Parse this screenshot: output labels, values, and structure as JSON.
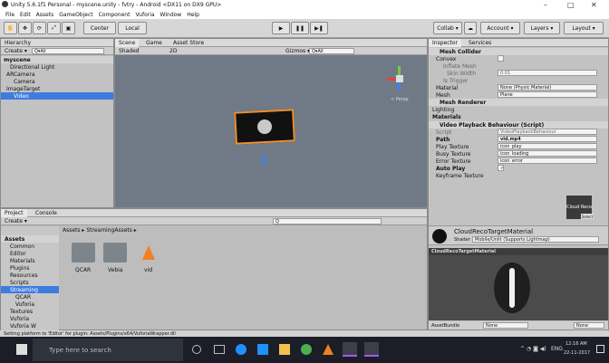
{
  "title": "Unity 5.6.1f1 Personal - myscene.unity - fvtry - Android <DX11 on DX9 GPU>",
  "menu": [
    "File",
    "Edit",
    "Assets",
    "GameObject",
    "Component",
    "Vuforia",
    "Window",
    "Help"
  ],
  "toolbar": {
    "center": "Center",
    "local": "Local",
    "collab": "Collab ▾",
    "account": "Account ▾",
    "layers": "Layers ▾",
    "layout": "Layout ▾"
  },
  "hierarchy": {
    "tab": "Hierarchy",
    "create": "Create ▾",
    "search": "Q▾All",
    "items": [
      "myscene",
      "Directional Light",
      "ARCamera",
      "Camera",
      "ImageTarget",
      "Video"
    ]
  },
  "scene": {
    "tab": "Scene",
    "game": "Game",
    "store": "Asset Store",
    "shaded": "Shaded",
    "d2": "2D",
    "gizmos": "Gizmos ▾",
    "persp": "< Persp"
  },
  "inspector": {
    "tab": "Inspector",
    "services": "Services",
    "mesh_collider": {
      "title": "Mesh Collider",
      "rows": [
        [
          "Convex",
          ""
        ],
        [
          "Inflate Mesh",
          ""
        ],
        [
          "Skin Width",
          "0.01"
        ],
        [
          "Is Trigger",
          ""
        ],
        [
          "Material",
          "None (Physic Material)"
        ],
        [
          "Mesh",
          "Plane"
        ]
      ]
    },
    "mesh_renderer": "Mesh Renderer",
    "lighting": "Lighting",
    "materials": "Materials",
    "video": {
      "title": "Video Playback Behaviour (Script)",
      "rows": [
        [
          "Script",
          "VideoPlaybackBehaviour"
        ],
        [
          "Path",
          "vid.mp4"
        ],
        [
          "Play Texture",
          "icon_play"
        ],
        [
          "Busy Texture",
          "icon_loading"
        ],
        [
          "Error Texture",
          "icon_error"
        ],
        [
          "Auto Play",
          ""
        ],
        [
          "Keyframe Texture",
          ""
        ]
      ]
    },
    "reco": "Cloud Reco",
    "select": "Select",
    "material": {
      "name": "CloudRecoTargetMaterial",
      "shader_label": "Shader",
      "shader": "Mobile/Unlit (Supports Lightmap)"
    },
    "preview": "CloudRecoTargetMaterial",
    "assetbundle": "AssetBundle",
    "none": "None"
  },
  "project": {
    "tab": "Project",
    "console": "Console",
    "create": "Create ▾",
    "breadcrumb": "Assets ▸ StreamingAssets ▸",
    "tree": [
      "Assets",
      "Common",
      "Editor",
      "Materials",
      "Plugins",
      "Resources",
      "Scripts",
      "Streaming",
      "QCAR",
      "Vuforia",
      "Textures",
      "Vuforia",
      "Vuforia W"
    ],
    "files": [
      "QCAR",
      "Vebia",
      "vid"
    ]
  },
  "status": "Setting platform to 'Editor' for plugin: Assets/Plugins/x64/VuforiaWrapper.dll",
  "taskbar": {
    "search": "Type here to search",
    "lang": "ENG",
    "time": "12:16 AM",
    "date": "22-11-2017"
  }
}
